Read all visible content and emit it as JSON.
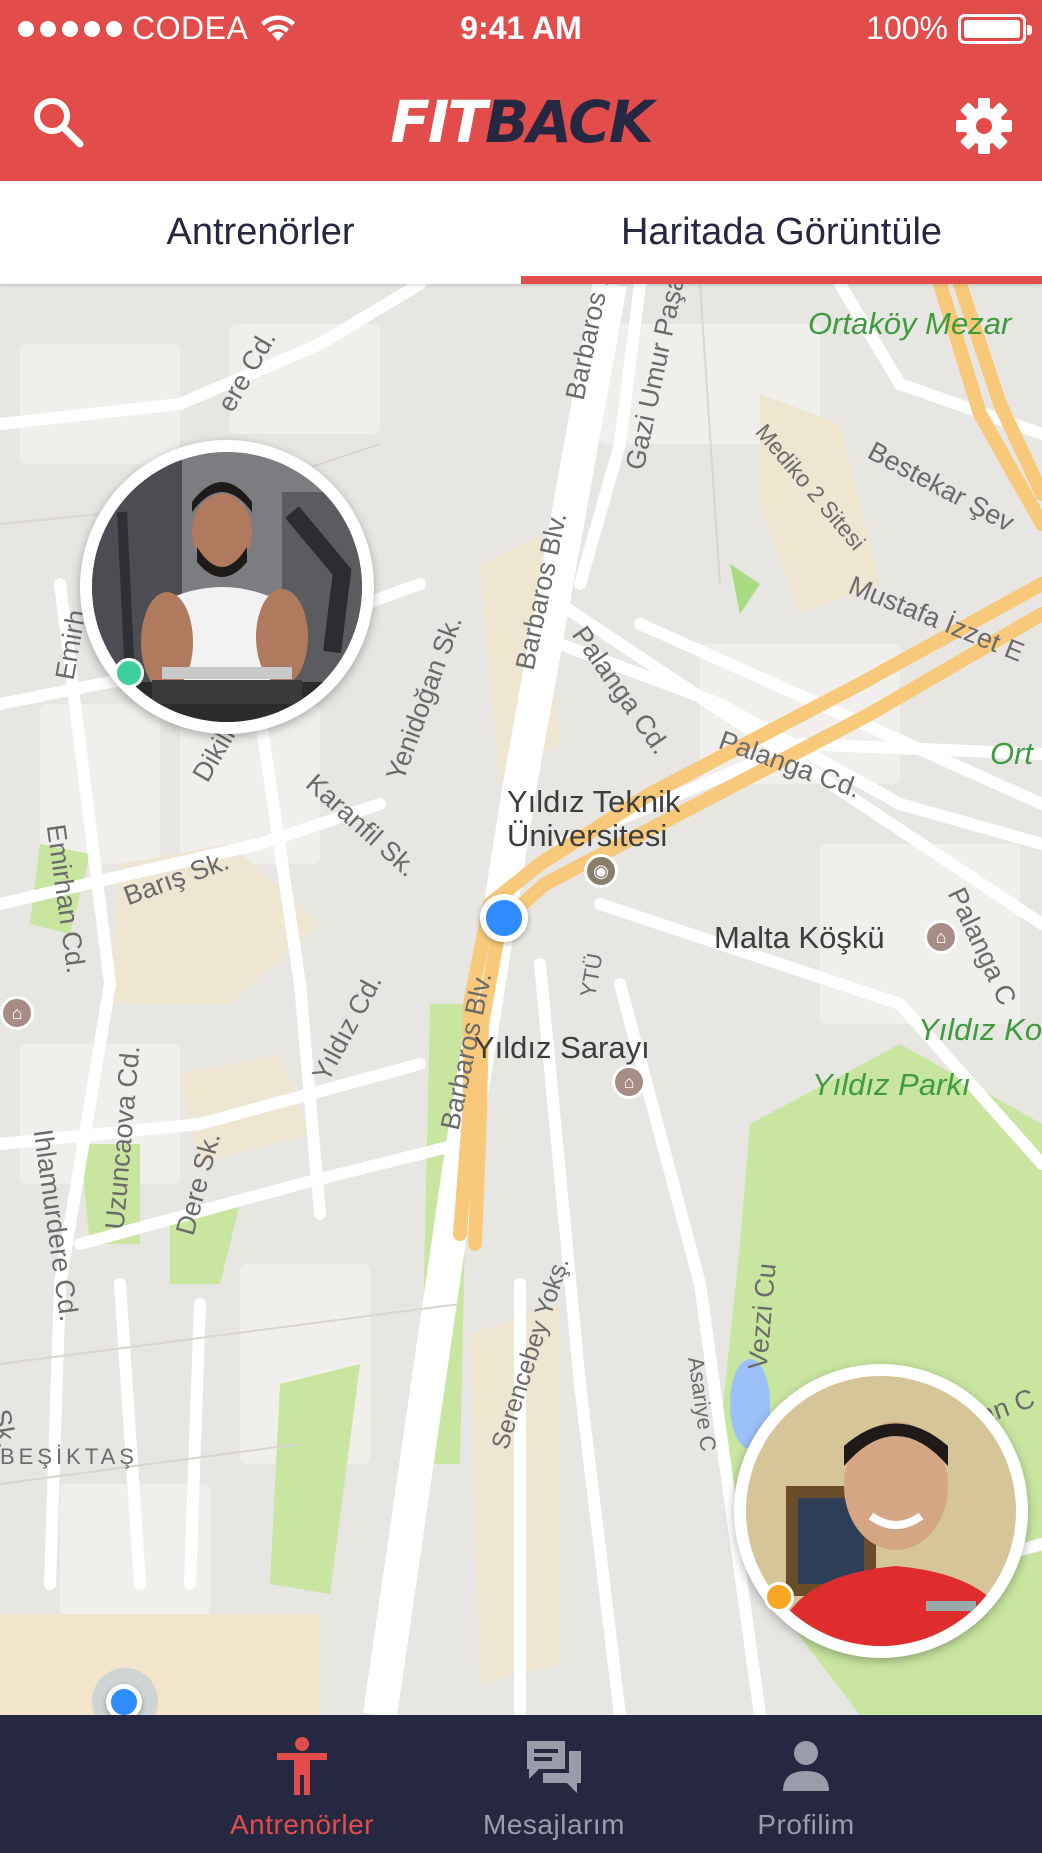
{
  "status_bar": {
    "carrier": "CODEA",
    "time": "9:41 AM",
    "battery": "100%"
  },
  "header": {
    "logo_part1": "FIT",
    "logo_part2": "BACK",
    "search_icon": "search-icon",
    "settings_icon": "gear-icon"
  },
  "tabs": [
    {
      "label": "Antrenörler",
      "active": false
    },
    {
      "label": "Haritada Görüntüle",
      "active": true
    }
  ],
  "map": {
    "labels": {
      "ortakoy": "Ortaköy Mezar",
      "ort": "Ort",
      "bestekar": "Bestekar Şev",
      "mediko": "Mediko 2 Sitesi",
      "mustafa": "Mustafa İzzet E",
      "palanga1": "Palanga Cd.",
      "palanga2": "Palanga Cd.",
      "palanga3": "Palanga C",
      "barbaros1": "Barbaros B",
      "barbaros2": "Barbaros Blv.",
      "barbaros3": "Barbaros Blv.",
      "gazi": "Gazi Umur Paşa S",
      "ere": "ere Cd.",
      "yenidogan": "Yenidoğan Sk.",
      "dikilitas": "Dikilitaş Sk.",
      "emirhan1": "Emirh",
      "emirhan2": "Emirhan Cd.",
      "karanfil": "Karanfil Sk.",
      "baris": "Barış Sk.",
      "ytu_name": "Yıldız Teknik",
      "ytu_name2": "Üniversitesi",
      "malta": "Malta Köşkü",
      "yildiz_k": "Yıldız Ko",
      "yildiz_parki": "Yıldız Parkı",
      "yildiz_sarayi": "Yıldız Sarayı",
      "yildiz_cd": "Yıldız Cd.",
      "ytu_short": "YTÜ",
      "uzuncaova": "Uzuncaova Cd.",
      "ihlamurdere": "Ihlamurdere Cd.",
      "dere": "Dere Sk.",
      "serencebey": "Serencebey Yokş.",
      "asariye": "Asariye C",
      "vezzi": "Vezzi Cu",
      "ciragan": "Çırağan C",
      "sk": "Sk.",
      "besiktas": "BEŞİKTAŞ"
    },
    "trainers": [
      {
        "name": "trainer-1",
        "status_color": "#3ecfa0"
      },
      {
        "name": "trainer-2",
        "status_color": "#f5a623"
      }
    ]
  },
  "bottom_nav": {
    "items": [
      {
        "label": "Antrenörler",
        "icon": "person-icon",
        "active": true
      },
      {
        "label": "Mesajlarım",
        "icon": "chat-bubbles-icon",
        "active": false
      },
      {
        "label": "Profilim",
        "icon": "profile-icon",
        "active": false
      }
    ]
  },
  "colors": {
    "brand_red": "#e24c4b",
    "navy": "#262741",
    "inactive_gray": "#9b9caa",
    "map_bg": "#e8e6e2",
    "park_green": "#c8e6a0",
    "road_orange": "#f8c97a"
  }
}
